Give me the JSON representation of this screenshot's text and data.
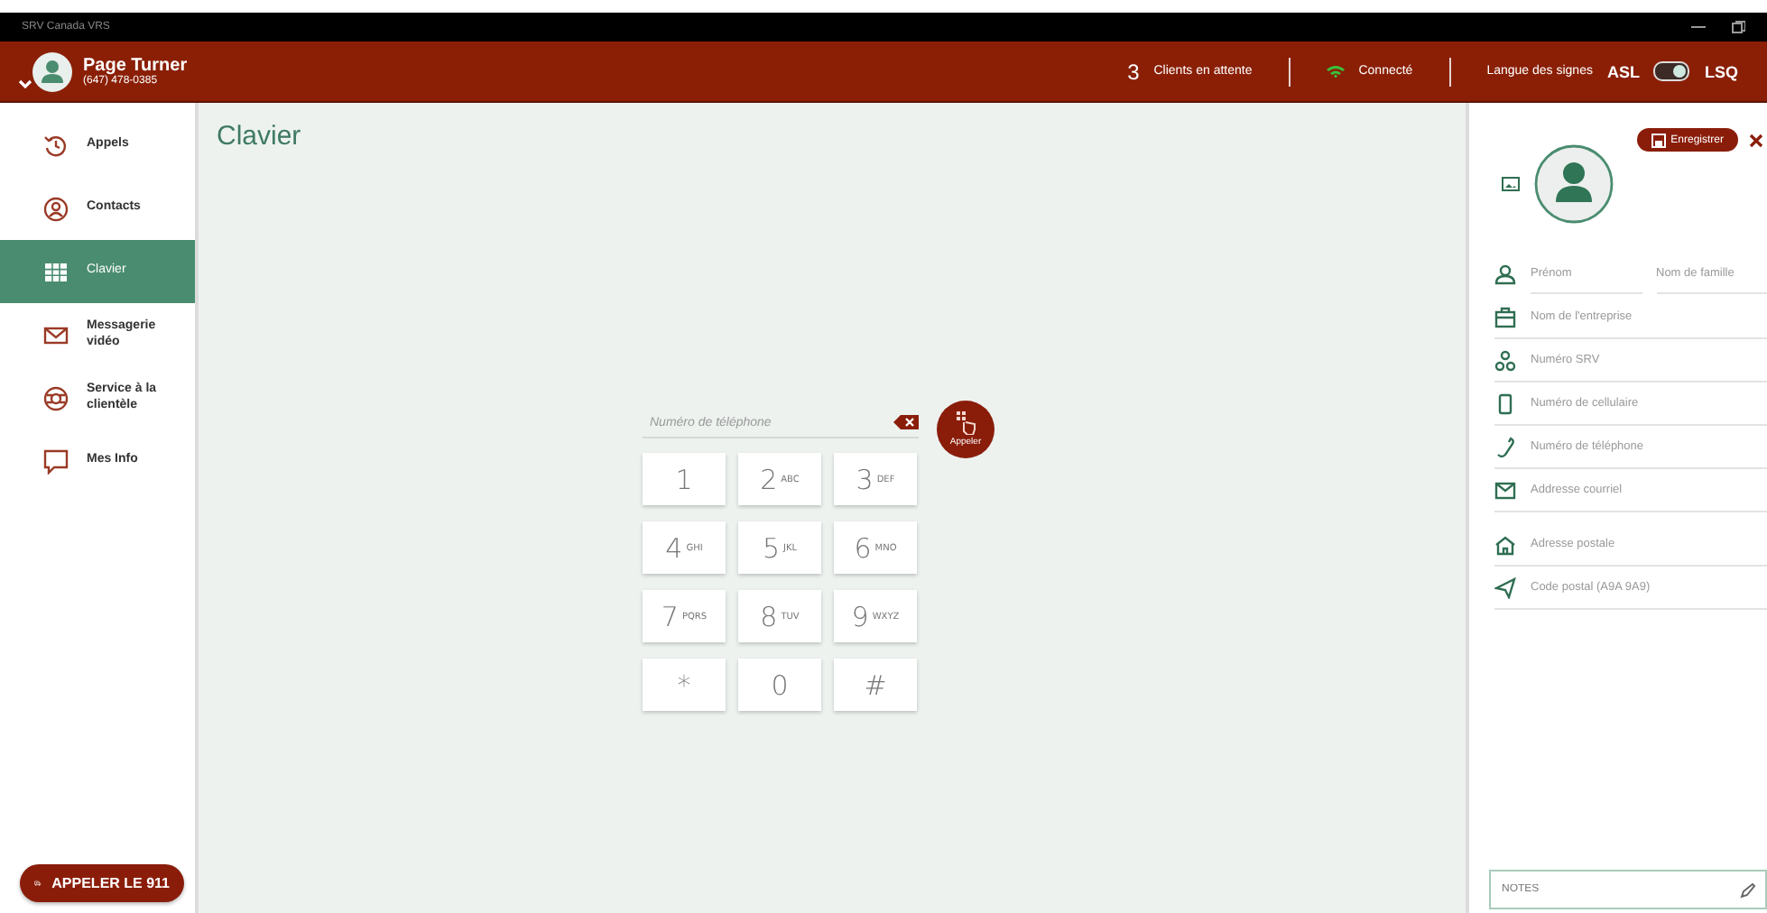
{
  "window": {
    "title": "SRV Canada VRS"
  },
  "header": {
    "user": {
      "name": "Page Turner",
      "phone": "(647) 478-0385"
    },
    "waiting_count": "3",
    "waiting_label": "Clients en attente",
    "connection": "Connecté",
    "sign_language_label": "Langue des signes",
    "language_left": "ASL",
    "language_right": "LSQ",
    "language_toggle_on": true
  },
  "sidebar": {
    "items": [
      {
        "label": "Appels",
        "selected": false
      },
      {
        "label": "Contacts",
        "selected": false
      },
      {
        "label": "Clavier",
        "selected": true
      },
      {
        "label": "Messagerie vidéo",
        "selected": false
      },
      {
        "label": "Service à la clientèle",
        "selected": false
      },
      {
        "label": "Mes Info",
        "selected": false
      }
    ],
    "emergency_button": "APPELER LE 911"
  },
  "main": {
    "title": "Clavier",
    "phone_field": {
      "placeholder": "Numéro de téléphone"
    },
    "call_button": "Appeler",
    "keys": [
      {
        "digit": "1"
      },
      {
        "digit": "2",
        "letters": "ABC"
      },
      {
        "digit": "3",
        "letters": "DEF"
      },
      {
        "digit": "4",
        "letters": "GHI"
      },
      {
        "digit": "5",
        "letters": "JKL"
      },
      {
        "digit": "6",
        "letters": "MNO"
      },
      {
        "digit": "7",
        "letters": "PQRS"
      },
      {
        "digit": "8",
        "letters": "TUV"
      },
      {
        "digit": "9",
        "letters": "WXYZ"
      },
      {
        "digit": "*"
      },
      {
        "digit": "0"
      },
      {
        "digit": "#"
      }
    ]
  },
  "contact_panel": {
    "save_button": "Enregistrer",
    "fields": [
      {
        "placeholders": [
          "Prénom",
          "Nom de famille"
        ]
      },
      {
        "placeholders": [
          "Nom de l'entreprise"
        ]
      },
      {
        "placeholders": [
          "Numéro SRV"
        ]
      },
      {
        "placeholders": [
          "Numéro de cellulaire"
        ]
      },
      {
        "placeholders": [
          "Numéro de téléphone"
        ]
      },
      {
        "placeholders": [
          "Addresse courriel"
        ]
      },
      {
        "placeholders": [
          "Adresse postale"
        ]
      },
      {
        "placeholders": [
          "Code postal (A9A 9A9)"
        ]
      }
    ],
    "notes": {
      "placeholder": "NOTES"
    }
  }
}
